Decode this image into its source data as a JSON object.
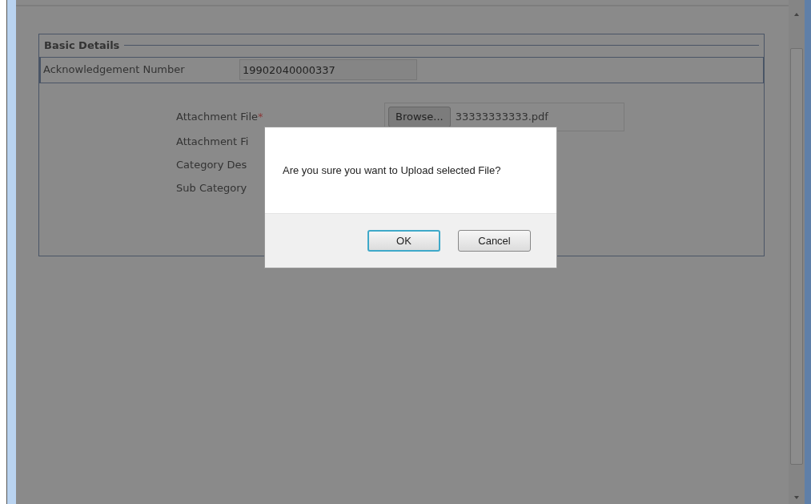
{
  "form": {
    "legend": "Basic Details",
    "acknowledgement": {
      "label": "Acknowledgement Number",
      "value": "19902040000337"
    },
    "attachment": {
      "label": "Attachment File",
      "required_mark": "*",
      "button": "Browse...",
      "file_name": "33333333333.pdf"
    },
    "labels": [
      "Attachment Fi",
      "Category Des",
      "Sub Category"
    ]
  },
  "dialog": {
    "message": "Are you sure you want to Upload selected File?",
    "buttons": [
      {
        "label": "OK",
        "selected": true
      },
      {
        "label": "Cancel",
        "selected": false
      }
    ]
  }
}
